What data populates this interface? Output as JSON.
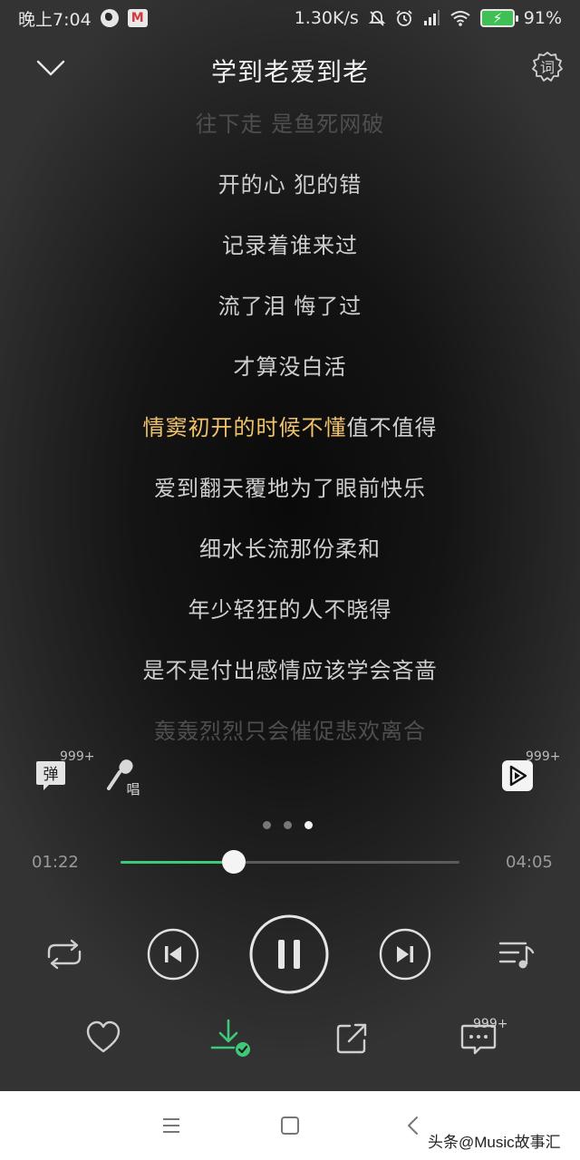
{
  "status_bar": {
    "time": "晚上7:04",
    "network_speed": "1.30K/s",
    "battery": "91%",
    "icons": [
      "globe-icon",
      "app-m-icon",
      "mute-icon",
      "alarm-icon",
      "signal-icon",
      "wifi-icon",
      "battery-icon"
    ],
    "app_icon_letter": "M"
  },
  "header": {
    "title": "学到老爱到老",
    "lyric_settings_glyph": "词",
    "icons": [
      "chevron-down-icon",
      "lyric-settings-icon"
    ]
  },
  "lyrics": {
    "lines": [
      {
        "text": "往下走 是鱼死网破",
        "state": "faded"
      },
      {
        "text": "开的心 犯的错",
        "state": "normal"
      },
      {
        "text": "记录着谁来过",
        "state": "normal"
      },
      {
        "text": "流了泪 悔了过",
        "state": "normal"
      },
      {
        "text": "才算没白活",
        "state": "normal"
      },
      {
        "text": "情窦初开的时候不懂值不值得",
        "state": "active"
      },
      {
        "text": "爱到翻天覆地为了眼前快乐",
        "state": "normal"
      },
      {
        "text": "细水长流那份柔和",
        "state": "normal"
      },
      {
        "text": "年少轻狂的人不晓得",
        "state": "normal"
      },
      {
        "text": "是不是付出感情应该学会吝啬",
        "state": "normal"
      },
      {
        "text": "轰轰烈烈只会催促悲欢离合",
        "state": "faded"
      }
    ],
    "active_sung": "情窦初开的时候不懂",
    "active_unsung": "值不值得"
  },
  "side_buttons": {
    "danmu_label": "弹",
    "danmu_count": "999+",
    "sing_label": "唱",
    "video_count": "999+"
  },
  "pager": {
    "count": 3,
    "active_index": 2
  },
  "playback": {
    "current_time": "01:22",
    "total_time": "04:05",
    "progress": 0.3347
  },
  "actions": {
    "comment_count": "999+"
  },
  "watermark": "头条@Music故事汇",
  "colors": {
    "accent_green": "#3ec87a",
    "active_lyric": "#f0c26b",
    "battery_green": "#3fbf55"
  }
}
